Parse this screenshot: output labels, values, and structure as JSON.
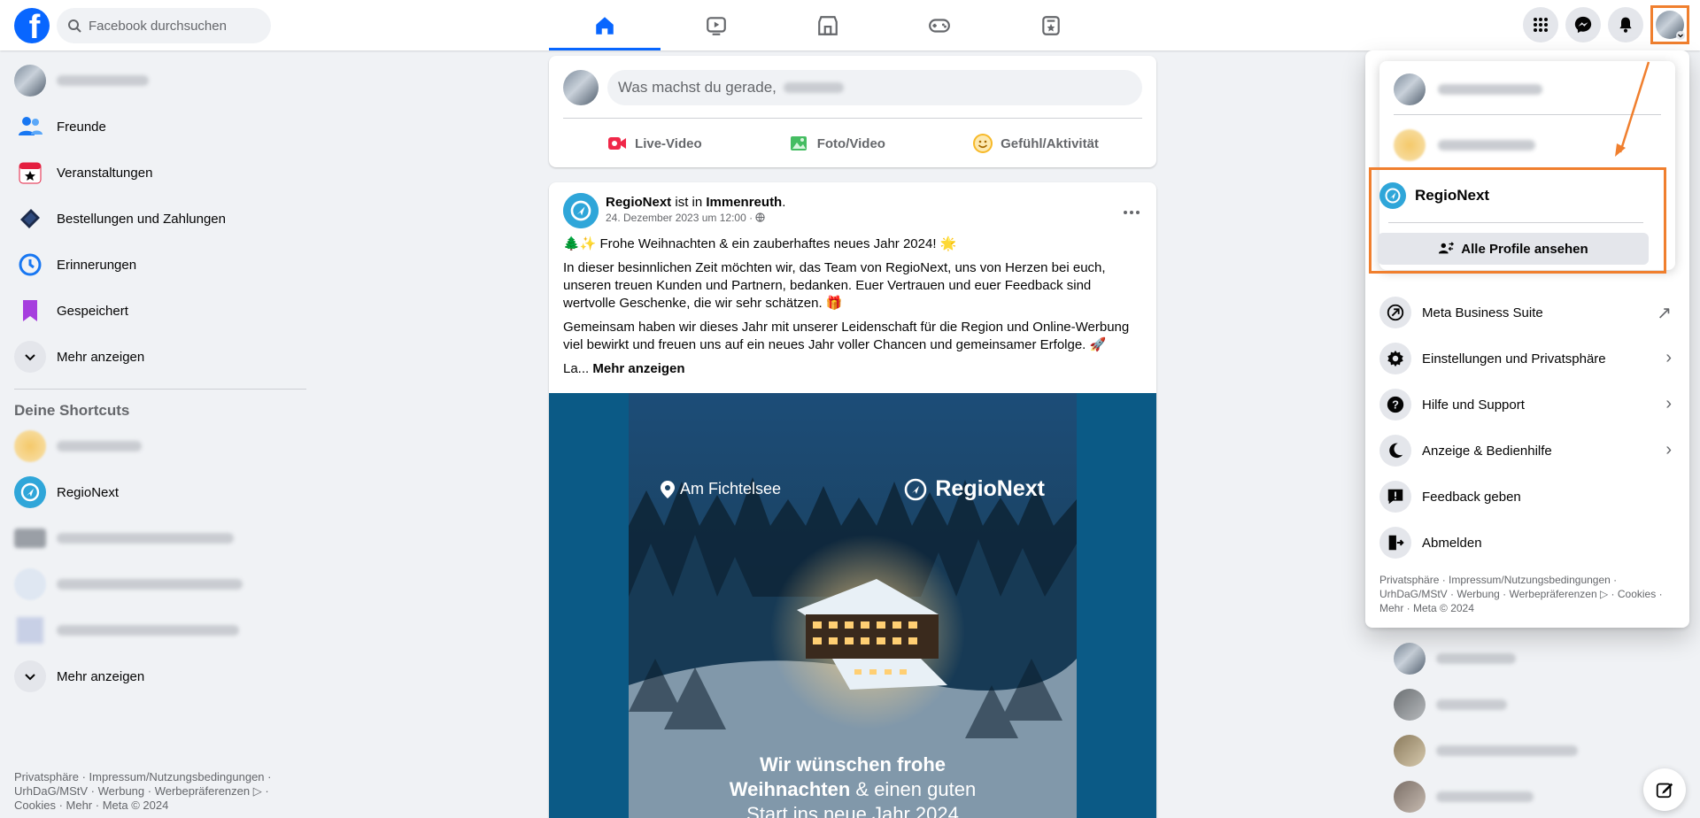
{
  "header": {
    "logo_letter": "f",
    "search_placeholder": "Facebook durchsuchen",
    "nav_tabs": [
      {
        "name": "home-icon",
        "active": true
      },
      {
        "name": "video-icon",
        "active": false
      },
      {
        "name": "marketplace-icon",
        "active": false
      },
      {
        "name": "gaming-icon",
        "active": false
      },
      {
        "name": "feeds-icon",
        "active": false
      }
    ],
    "right_icons": [
      "menu-grid-icon",
      "messenger-icon",
      "bell-icon",
      "profile-avatar"
    ]
  },
  "left_sidebar": {
    "items": [
      {
        "label": "Freunde",
        "icon": "friends-icon"
      },
      {
        "label": "Veranstaltungen",
        "icon": "calendar-icon"
      },
      {
        "label": "Bestellungen und Zahlungen",
        "icon": "payments-icon"
      },
      {
        "label": "Erinnerungen",
        "icon": "clock-icon"
      },
      {
        "label": "Gespeichert",
        "icon": "bookmark-icon"
      },
      {
        "label": "Mehr anzeigen",
        "icon": "chevron-down-icon"
      }
    ],
    "shortcuts_title": "Deine Shortcuts",
    "shortcuts": [
      {
        "label": "RegioNext",
        "icon": "regionext-logo-icon"
      }
    ],
    "shortcuts_more": "Mehr anzeigen",
    "footer": "Privatsphäre · Impressum/Nutzungsbedingungen · UrhDaG/MStV · Werbung · Werbepräferenzen ▷ · Cookies · Mehr · Meta © 2024"
  },
  "composer": {
    "placeholder": "Was machst du gerade,",
    "actions": [
      {
        "label": "Live-Video",
        "icon": "live-video-icon",
        "color": "#f02849"
      },
      {
        "label": "Foto/Video",
        "icon": "photo-icon",
        "color": "#45bd62"
      },
      {
        "label": "Gefühl/Aktivität",
        "icon": "smiley-icon",
        "color": "#f7b928"
      }
    ]
  },
  "post": {
    "author": "RegioNext",
    "location_prefix": "ist in",
    "location": "Immenreuth",
    "location_suffix": ".",
    "timestamp": "24. Dezember 2023 um 12:00 ·",
    "line1": "🌲✨ Frohe Weihnachten & ein zauberhaftes neues Jahr 2024! 🌟",
    "paragraph1": "In dieser besinnlichen Zeit möchten wir, das Team von RegioNext, uns von Herzen bei euch, unseren treuen Kunden und Partnern, bedanken. Euer Vertrauen und euer Feedback sind wertvolle Geschenke, die wir sehr schätzen. 🎁",
    "paragraph2": "Gemeinsam haben wir dieses Jahr mit unserer Leidenschaft für die Region und Online-Werbung viel bewirkt und freuen uns auf ein neues Jahr voller Chancen und gemeinsamer Erfolge. 🚀",
    "truncated": "La...",
    "more_link": "Mehr anzeigen",
    "image": {
      "location_label": "Am Fichtelsee",
      "brand": "RegioNext",
      "caption_bold_1": "Wir wünschen frohe",
      "caption_bold_2": "Weihnachten",
      "caption_rest_2": " & einen guten",
      "caption_3": "Start ins neue Jahr 2024"
    }
  },
  "dropdown": {
    "regionext_name": "RegioNext",
    "all_profiles_label": "Alle Profile ansehen",
    "menu": [
      {
        "label": "Meta Business Suite",
        "icon": "business-suite-icon",
        "chevron": "↗"
      },
      {
        "label": "Einstellungen und Privatsphäre",
        "icon": "gear-icon",
        "chevron": "›"
      },
      {
        "label": "Hilfe und Support",
        "icon": "help-icon",
        "chevron": "›"
      },
      {
        "label": "Anzeige & Bedienhilfe",
        "icon": "moon-icon",
        "chevron": "›"
      },
      {
        "label": "Feedback geben",
        "icon": "feedback-icon",
        "chevron": ""
      },
      {
        "label": "Abmelden",
        "icon": "logout-icon",
        "chevron": ""
      }
    ],
    "footer": "Privatsphäre · Impressum/Nutzungsbedingungen · UrhDaG/MStV · Werbung · Werbepräferenzen ▷ · Cookies · Mehr · Meta © 2024"
  },
  "colors": {
    "brand": "#0866ff",
    "highlight": "#f07f2e",
    "regionext": "#2fa6d9"
  }
}
